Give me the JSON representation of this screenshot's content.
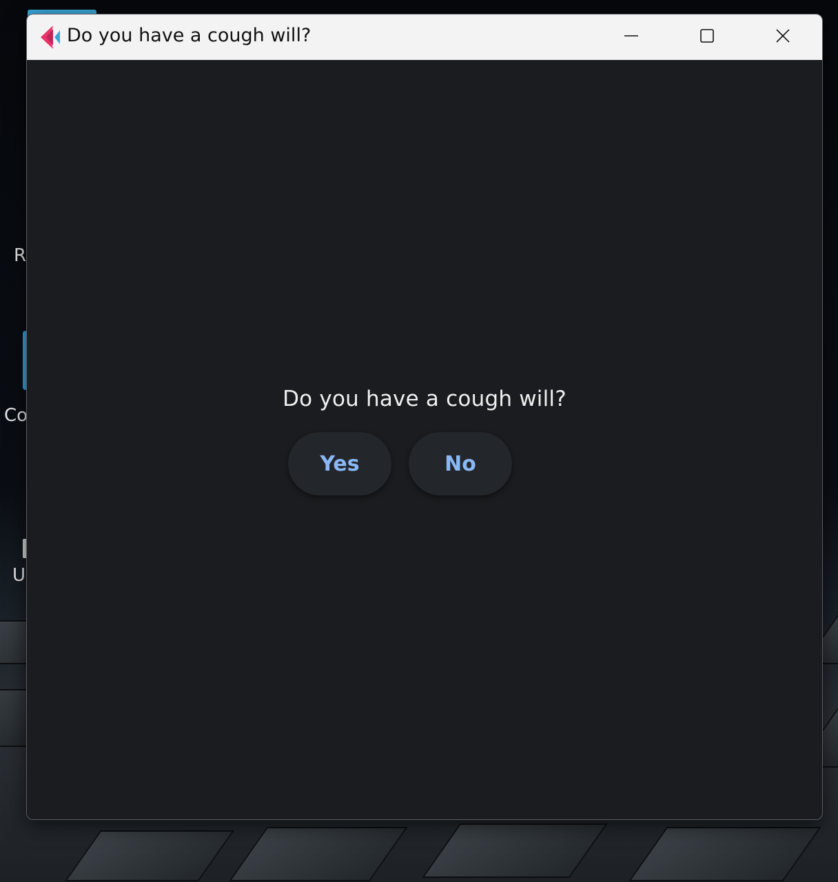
{
  "window": {
    "title": "Do you have a cough will?",
    "app_icon": "app-logo-icon",
    "controls": {
      "minimize_icon": "minimize-icon",
      "maximize_icon": "maximize-icon",
      "close_icon": "close-icon"
    }
  },
  "dialog": {
    "question": "Do you have a cough will?",
    "yes_label": "Yes",
    "no_label": "No"
  },
  "desktop": {
    "labels": [
      "R",
      "Co",
      "U"
    ]
  },
  "colors": {
    "window_bg": "#1b1c1f",
    "titlebar_bg": "#f3f3f3",
    "button_bg": "#23262b",
    "button_text": "#8ab8f4",
    "icon_pink": "#e8336b",
    "icon_blue": "#3aa6d8"
  }
}
